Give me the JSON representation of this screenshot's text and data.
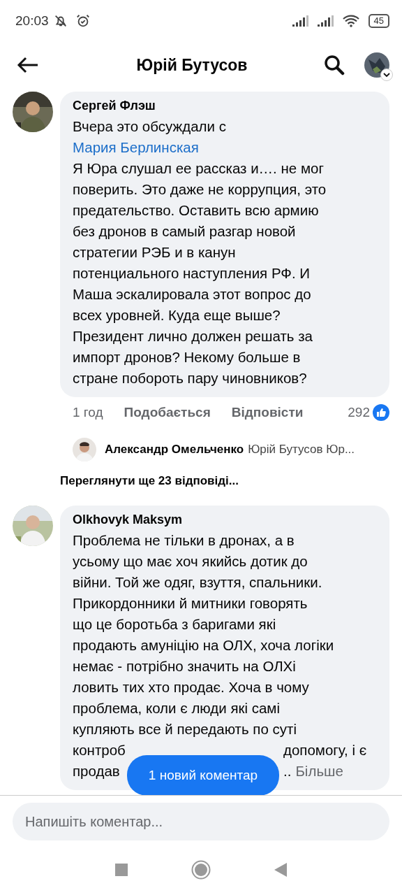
{
  "status_bar": {
    "time": "20:03",
    "battery": "45"
  },
  "header": {
    "title": "Юрій Бутусов"
  },
  "comments": [
    {
      "author": "Сергей Флэш",
      "intro": "Вчера это обсуждали с",
      "mention": "Мария Берлинская",
      "text": "Я Юра слушал ее рассказ и…. не мог\nповерить. Это даже не коррупция, это\nпредательство. Оставить всю армию\nбез дронов в самый разгар новой\nстратегии РЭБ и в канун\nпотенциального наступления РФ. И\nМаша эскалировала этот вопрос до\nвсех уровней. Куда еще выше?\nПрезидент лично должен решать за\nимпорт дронов? Некому больше в\nстране побороть пару чиновников?",
      "time": "1 год",
      "like": "Подобається",
      "reply": "Відповісти",
      "reactions": "292",
      "reply_preview": {
        "author": "Александр Омельченко",
        "text": "Юрій Бутусов Юр..."
      },
      "more_replies": "Переглянути ще 23 відповіді..."
    },
    {
      "author": "Olkhovyk Maksym",
      "text": "Проблема не тільки в дронах, а в\nусьому що має хоч якийсь дотик до\nвійни. Той же одяг, взуття, спальники.\nПрикордонники й митники говорять\nщо це боротьба з баригами які\nпродають амуніцію на ОЛХ, хоча логіки\nнемає - потрібно значить на ОЛХі\nловить тих хто продає. Хоча в чому\nпроблема, коли є люди які самі\nкупляють все й передають по суті",
      "covered_lines": [
        {
          "left": "контроб",
          "right": "допомогу, і є"
        },
        {
          "left": "продав",
          "right": ".."
        }
      ],
      "more": "Більше"
    }
  ],
  "new_comments_pill": "1 новий коментар",
  "composer": {
    "placeholder": "Напишіть коментар..."
  }
}
